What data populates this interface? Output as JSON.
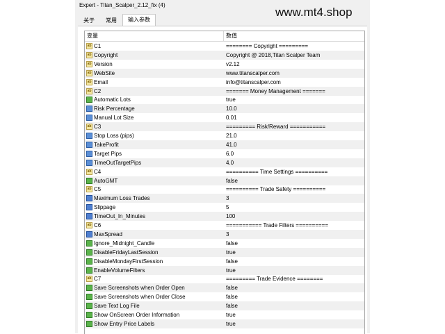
{
  "window": {
    "title": "Expert - Titan_Scalper_2.12_fix (4)",
    "watermark": "www.mt4.shop"
  },
  "tabs": [
    {
      "label": "关于",
      "active": false
    },
    {
      "label": "常用",
      "active": false
    },
    {
      "label": "输入参数",
      "active": true
    }
  ],
  "table": {
    "col_variable": "变量",
    "col_value": "数值",
    "rows": [
      {
        "name": "C1",
        "value": "======== Copyright =========",
        "icon": "string-icon"
      },
      {
        "name": "Copyright",
        "value": "Copyright @ 2018,Titan Scalper Team",
        "icon": "string-icon"
      },
      {
        "name": "Version",
        "value": "v2.12",
        "icon": "string-icon"
      },
      {
        "name": "WebSite",
        "value": "www.titanscalper.com",
        "icon": "string-icon"
      },
      {
        "name": "Email",
        "value": "info@titanscalper.com",
        "icon": "string-icon"
      },
      {
        "name": "C2",
        "value": "======= Money Management =======",
        "icon": "string-icon"
      },
      {
        "name": "Automatic Lots",
        "value": "true",
        "icon": "bool-icon"
      },
      {
        "name": "Risk Percentage",
        "value": "10.0",
        "icon": "double-icon"
      },
      {
        "name": "Manual Lot Size",
        "value": "0.01",
        "icon": "double-icon"
      },
      {
        "name": "C3",
        "value": "========= Risk/Reward ===========",
        "icon": "string-icon"
      },
      {
        "name": "Stop Loss (pips)",
        "value": "21.0",
        "icon": "double-icon"
      },
      {
        "name": "TakeProfit",
        "value": "41.0",
        "icon": "double-icon"
      },
      {
        "name": "Target Pips",
        "value": "6.0",
        "icon": "double-icon"
      },
      {
        "name": "TimeOutTargetPips",
        "value": "4.0",
        "icon": "double-icon"
      },
      {
        "name": "C4",
        "value": "========== Time Settings ==========",
        "icon": "string-icon"
      },
      {
        "name": "AutoGMT",
        "value": "false",
        "icon": "bool-icon"
      },
      {
        "name": "C5",
        "value": "========== Trade Safety ==========",
        "icon": "string-icon"
      },
      {
        "name": "Maximum Loss Trades",
        "value": "3",
        "icon": "int-icon"
      },
      {
        "name": "Slippage",
        "value": "5",
        "icon": "int-icon"
      },
      {
        "name": "TimeOut_In_Minutes",
        "value": "100",
        "icon": "int-icon"
      },
      {
        "name": "C6",
        "value": "=========== Trade Filters ==========",
        "icon": "string-icon"
      },
      {
        "name": "MaxSpread",
        "value": "3",
        "icon": "int-icon"
      },
      {
        "name": "Ignore_Midnight_Candle",
        "value": "false",
        "icon": "bool-icon"
      },
      {
        "name": "DisableFridayLastSession",
        "value": "true",
        "icon": "bool-icon"
      },
      {
        "name": "DisableMondayFirstSession",
        "value": "false",
        "icon": "bool-icon"
      },
      {
        "name": "EnableVolumeFilters",
        "value": "true",
        "icon": "bool-icon"
      },
      {
        "name": "C7",
        "value": "========= Trade Evidence ========",
        "icon": "string-icon"
      },
      {
        "name": "Save Screenshots when Order Open",
        "value": "false",
        "icon": "bool-icon"
      },
      {
        "name": "Save Screenshots when Order Close",
        "value": "false",
        "icon": "bool-icon"
      },
      {
        "name": "Save Text Log File",
        "value": "false",
        "icon": "bool-icon"
      },
      {
        "name": "Show OnScreen Order Information",
        "value": "true",
        "icon": "bool-icon"
      },
      {
        "name": "Show Entry Price Labels",
        "value": "true",
        "icon": "bool-icon"
      }
    ]
  }
}
